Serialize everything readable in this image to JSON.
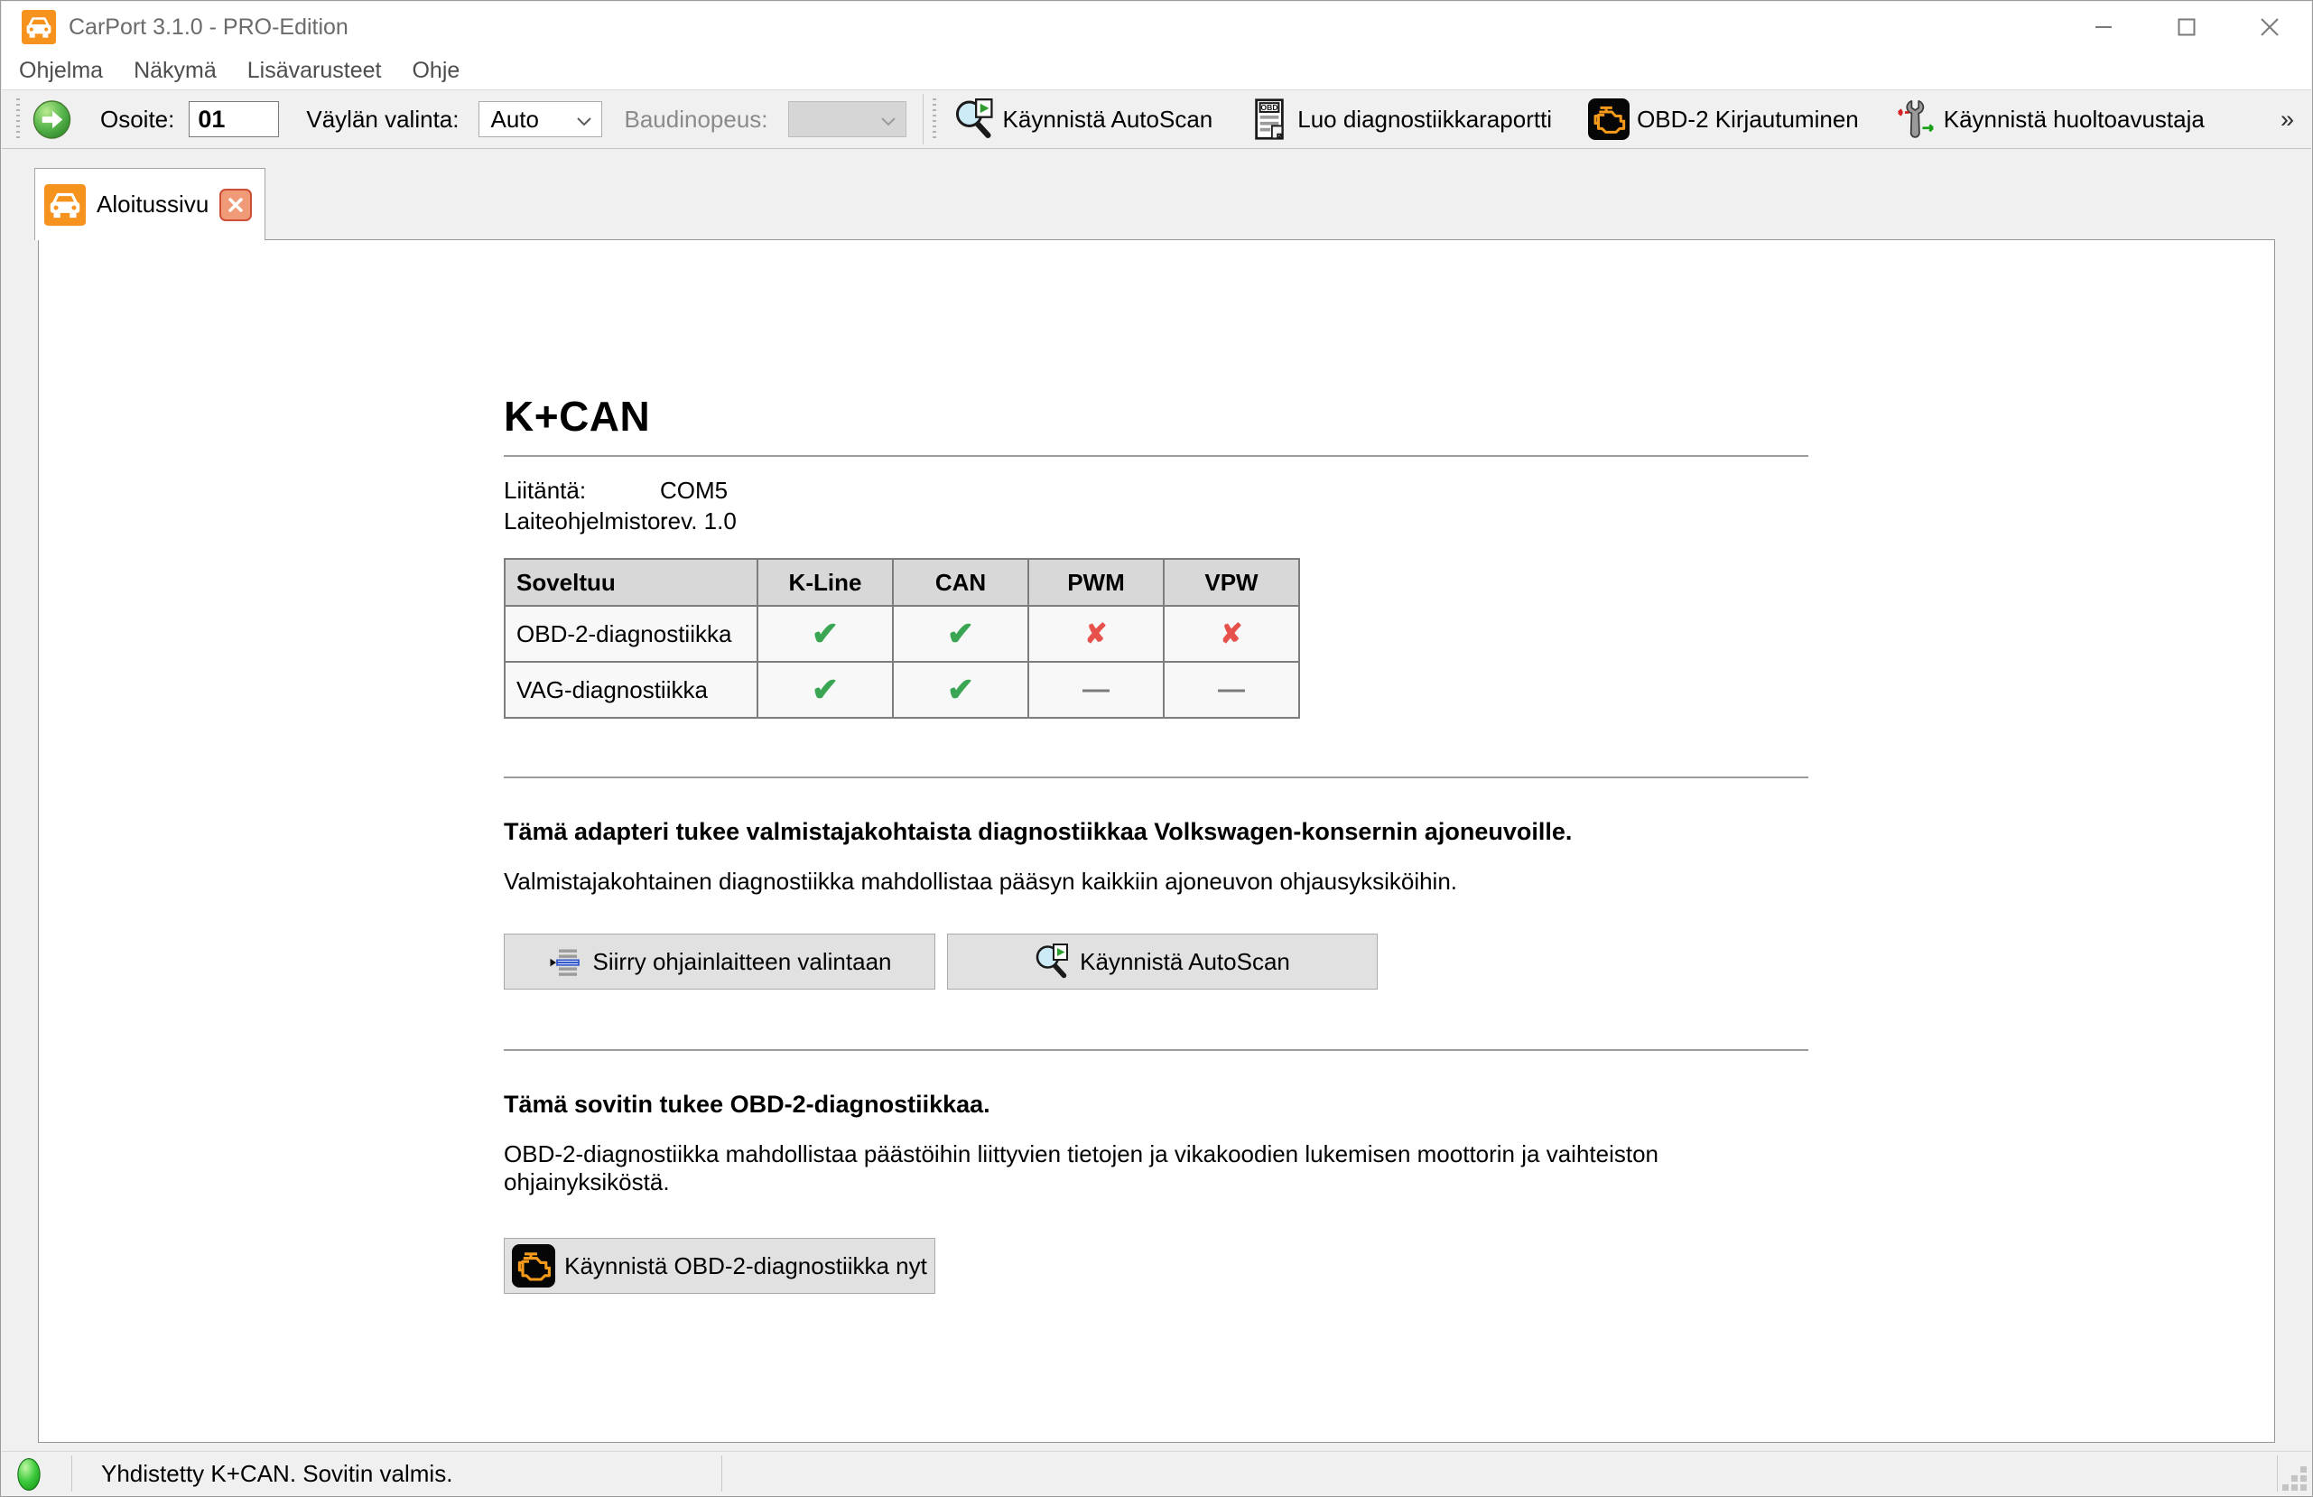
{
  "colors": {
    "accent_orange": "#f6921e",
    "check_green": "#3aa653",
    "cross_red": "#e6514c",
    "led_green": "#3ecb3e",
    "tab_close_red": "#cf4f36",
    "window_chrome": "#ffffff",
    "toolbar_gray": "#f0f0f0"
  },
  "icons": {
    "app": "car-icon",
    "run": "green-arrow-icon",
    "autoscan": "magnifier-play-icon",
    "report": "obd-report-icon",
    "report_doc_text": "OBD",
    "obd2": "engine-icon",
    "assistant": "wrench-icon",
    "ecu_select": "ecu-list-icon",
    "status": "green-led-icon"
  },
  "window": {
    "title": "CarPort 3.1.0 - PRO-Edition"
  },
  "menu": {
    "items": [
      "Ohjelma",
      "Näkymä",
      "Lisävarusteet",
      "Ohje"
    ]
  },
  "toolbar": {
    "address_label": "Osoite:",
    "address_value": "01",
    "bus_label": "Väylän valinta:",
    "bus_value": "Auto",
    "baud_label": "Baudinopeus:",
    "baud_value": "",
    "autoscan_label": "Käynnistä AutoScan",
    "report_label": "Luo diagnostiikkaraportti",
    "obd2_label": "OBD-2 Kirjautuminen",
    "assistant_label": "Käynnistä huoltoavustaja",
    "overflow": "»"
  },
  "tab": {
    "label": "Aloitussivu"
  },
  "content": {
    "heading": "K+CAN",
    "info": {
      "rows": [
        {
          "label": "Liitäntä:",
          "value": "COM5"
        },
        {
          "label": "Laiteohjelmisto:",
          "value": "rev. 1.0"
        }
      ]
    },
    "table": {
      "headers": [
        "Soveltuu",
        "K-Line",
        "CAN",
        "PWM",
        "VPW"
      ],
      "rows": [
        {
          "label": "OBD-2-diagnostiikka",
          "marks": [
            {
              "type": "check",
              "glyph": "✔"
            },
            {
              "type": "check",
              "glyph": "✔"
            },
            {
              "type": "cross",
              "glyph": "✘"
            },
            {
              "type": "cross",
              "glyph": "✘"
            }
          ]
        },
        {
          "label": "VAG-diagnostiikka",
          "marks": [
            {
              "type": "check",
              "glyph": "✔"
            },
            {
              "type": "check",
              "glyph": "✔"
            },
            {
              "type": "dash",
              "glyph": "—"
            },
            {
              "type": "dash",
              "glyph": "—"
            }
          ]
        }
      ]
    },
    "section_vag": {
      "heading": "Tämä adapteri tukee valmistajakohtaista diagnostiikkaa Volkswagen-konsernin ajoneuvoille.",
      "body": "Valmistajakohtainen diagnostiikka mahdollistaa pääsyn kaikkiin ajoneuvon ohjausyksiköihin.",
      "select_ecu_button": "Siirry ohjainlaitteen valintaan",
      "autoscan_button": "Käynnistä AutoScan"
    },
    "section_obd": {
      "heading": "Tämä sovitin tukee OBD-2-diagnostiikkaa.",
      "body": "OBD-2-diagnostiikka mahdollistaa päästöihin liittyvien tietojen ja vikakoodien lukemisen moottorin ja vaihteiston ohjainyksiköstä.",
      "start_button": "Käynnistä OBD-2-diagnostiikka nyt"
    }
  },
  "statusbar": {
    "text": "Yhdistetty K+CAN. Sovitin valmis."
  }
}
